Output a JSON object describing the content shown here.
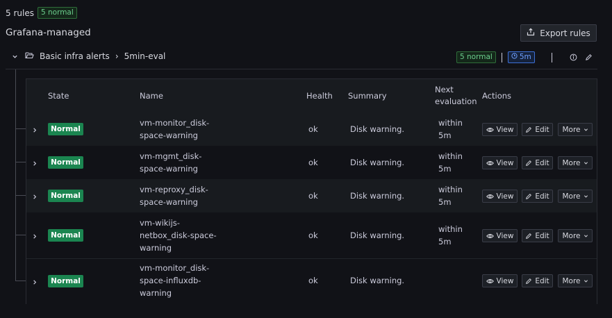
{
  "summary": {
    "rules_count": "5 rules",
    "normal_badge": "5 normal"
  },
  "namespace": {
    "title": "Grafana-managed"
  },
  "export_button": {
    "label": "Export rules",
    "icon": "export-icon"
  },
  "group": {
    "folder": "Basic infra alerts",
    "separator": "›",
    "name": "5min-eval",
    "normal_badge": "5 normal",
    "interval": "5m"
  },
  "table": {
    "headers": {
      "state": "State",
      "name": "Name",
      "health": "Health",
      "summary": "Summary",
      "next_eval_line1": "Next",
      "next_eval_line2": "evaluation",
      "actions": "Actions"
    },
    "rows": [
      {
        "state": "Normal",
        "name_lines": [
          "vm-monitor_disk-",
          "space-warning"
        ],
        "health": "ok",
        "summary": "Disk warning.",
        "next_eval_lines": [
          "within",
          "5m"
        ],
        "view": "View",
        "edit": "Edit",
        "more": "More"
      },
      {
        "state": "Normal",
        "name_lines": [
          "vm-mgmt_disk-",
          "space-warning"
        ],
        "health": "ok",
        "summary": "Disk warning.",
        "next_eval_lines": [
          "within",
          "5m"
        ],
        "view": "View",
        "edit": "Edit",
        "more": "More"
      },
      {
        "state": "Normal",
        "name_lines": [
          "vm-reproxy_disk-",
          "space-warning"
        ],
        "health": "ok",
        "summary": "Disk warning.",
        "next_eval_lines": [
          "within",
          "5m"
        ],
        "view": "View",
        "edit": "Edit",
        "more": "More"
      },
      {
        "state": "Normal",
        "name_lines": [
          "vm-wikijs-",
          "netbox_disk-space-",
          "warning"
        ],
        "health": "ok",
        "summary": "Disk warning.",
        "next_eval_lines": [
          "within",
          "5m"
        ],
        "view": "View",
        "edit": "Edit",
        "more": "More"
      },
      {
        "state": "Normal",
        "name_lines": [
          "vm-monitor_disk-",
          "space-influxdb-",
          "warning"
        ],
        "health": "ok",
        "summary": "Disk warning.",
        "next_eval_lines": [
          "",
          ""
        ],
        "view": "View",
        "edit": "Edit",
        "more": "More"
      }
    ]
  },
  "colors": {
    "background": "#111217",
    "row_alt": "#181b1f",
    "state_normal": "#1b8550",
    "interval_blue": "#6e9fff"
  }
}
